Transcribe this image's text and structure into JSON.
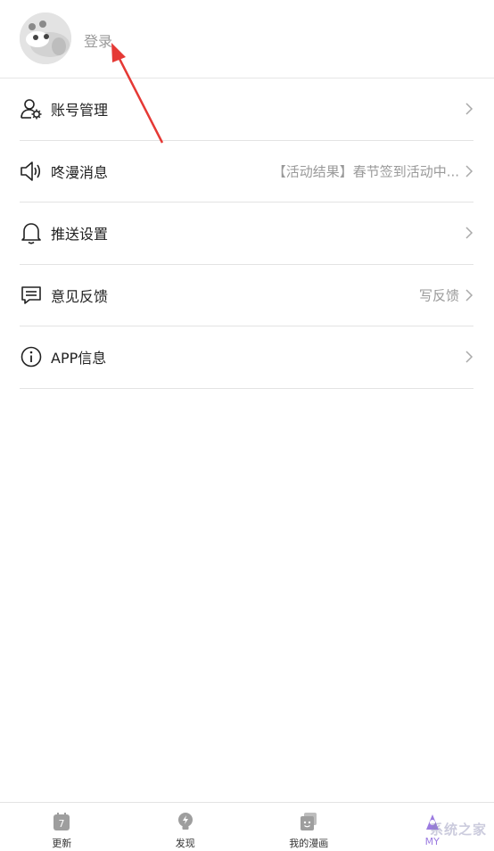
{
  "header": {
    "login_label": "登录"
  },
  "menu": {
    "items": [
      {
        "label": "账号管理",
        "value": "",
        "icon": "user-gear-icon"
      },
      {
        "label": "咚漫消息",
        "value": "【活动结果】春节签到活动中...",
        "icon": "speaker-icon"
      },
      {
        "label": "推送设置",
        "value": "",
        "icon": "bell-icon"
      },
      {
        "label": "意见反馈",
        "value": "写反馈",
        "icon": "chat-icon"
      },
      {
        "label": "APP信息",
        "value": "",
        "icon": "info-icon"
      }
    ]
  },
  "tabbar": {
    "tabs": [
      {
        "label": "更新",
        "icon": "calendar-icon",
        "badge": "7"
      },
      {
        "label": "发现",
        "icon": "lightbulb-icon"
      },
      {
        "label": "我的漫画",
        "icon": "comic-icon"
      },
      {
        "label": "MY",
        "icon": "my-icon",
        "active": true
      }
    ]
  },
  "colors": {
    "accent": "#9b7be0",
    "arrow": "#e53935",
    "divider": "#e3e3e3",
    "muted": "#9a9a9a"
  },
  "watermark": {
    "text": "系统之家"
  }
}
